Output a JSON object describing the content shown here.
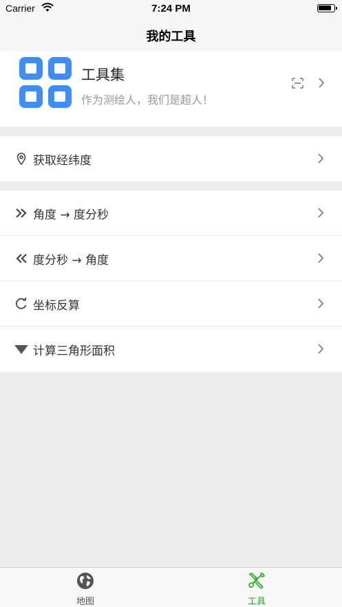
{
  "status_bar": {
    "carrier": "Carrier",
    "time": "7:24 PM"
  },
  "nav": {
    "title": "我的工具"
  },
  "header": {
    "app_name": "工具集",
    "slogan": "作为测绘人，我们是超人！",
    "logo_color": "#3d8ef7"
  },
  "sections": [
    {
      "items": [
        {
          "label": "获取经纬度",
          "icon": "location-pin-icon"
        }
      ]
    },
    {
      "items": [
        {
          "label": "角度 → 度分秒",
          "icon": "double-chevron-right-icon"
        },
        {
          "label": "度分秒 → 角度",
          "icon": "double-chevron-left-icon"
        },
        {
          "label": "坐标反算",
          "icon": "refresh-icon"
        },
        {
          "label": "计算三角形面积",
          "icon": "triangle-down-icon"
        }
      ]
    }
  ],
  "tab_bar": {
    "tabs": [
      {
        "label": "地图",
        "icon": "globe-icon",
        "active": false
      },
      {
        "label": "工具",
        "icon": "tools-icon",
        "active": true
      }
    ],
    "active_color": "#1aad19",
    "inactive_color": "#555555"
  }
}
